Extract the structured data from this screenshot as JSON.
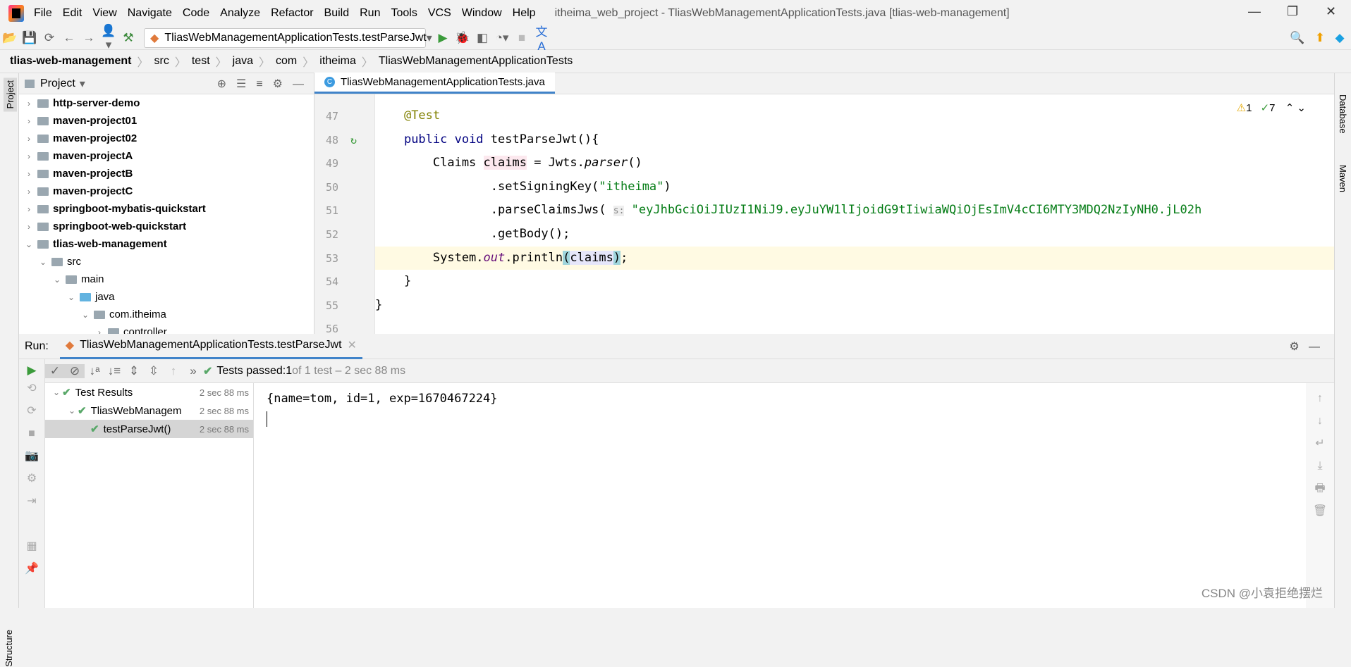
{
  "menu": [
    "File",
    "Edit",
    "View",
    "Navigate",
    "Code",
    "Analyze",
    "Refactor",
    "Build",
    "Run",
    "Tools",
    "VCS",
    "Window",
    "Help"
  ],
  "window_title": "itheima_web_project - TliasWebManagementApplicationTests.java [tlias-web-management]",
  "run_config": "TliasWebManagementApplicationTests.testParseJwt",
  "breadcrumb": [
    "tlias-web-management",
    "src",
    "test",
    "java",
    "com",
    "itheima",
    "TliasWebManagementApplicationTests"
  ],
  "project": {
    "label": "Project",
    "items": [
      {
        "label": "http-server-demo",
        "level": 0
      },
      {
        "label": "maven-project01",
        "level": 0
      },
      {
        "label": "maven-project02",
        "level": 0
      },
      {
        "label": "maven-projectA",
        "level": 0
      },
      {
        "label": "maven-projectB",
        "level": 0
      },
      {
        "label": "maven-projectC",
        "level": 0
      },
      {
        "label": "springboot-mybatis-quickstart",
        "level": 0
      },
      {
        "label": "springboot-web-quickstart",
        "level": 0
      },
      {
        "label": "tlias-web-management",
        "level": 0
      },
      {
        "label": "src",
        "level": 1
      },
      {
        "label": "main",
        "level": 2
      },
      {
        "label": "java",
        "level": 3
      },
      {
        "label": "com.itheima",
        "level": 4
      },
      {
        "label": "controller",
        "level": 5
      }
    ]
  },
  "editor": {
    "tab": "TliasWebManagementApplicationTests.java",
    "warnings": "1",
    "checks": "7",
    "lines": [
      {
        "n": "47",
        "html": "    <span class='an'>@Test</span>"
      },
      {
        "n": "48",
        "html": "    <span class='kw'>public void</span> testParseJwt(){"
      },
      {
        "n": "49",
        "html": "        Claims <span style='background:#fce8ee'>claims</span> = Jwts.<span class='it'>parser</span>()"
      },
      {
        "n": "50",
        "html": "                .setSigningKey(<span class='str'>\"itheima\"</span>)"
      },
      {
        "n": "51",
        "html": "                .parseClaimsJws( <span style='color:#888;background:#eee;font-size:13px'>s:</span> <span class='str'>\"eyJhbGciOiJIUzI1NiJ9.eyJuYW1lIjoidG9tIiwiaWQiOjEsImV4cCI6MTY3MDQ2NzIyNH0.jL02h</span>"
      },
      {
        "n": "52",
        "html": "                .getBody();"
      },
      {
        "n": "53",
        "html": "        System.<span class='out'>out</span>.println<span style='background:#9fd5dc'>(</span><span style='background:#e6e6fa'>claims</span><span style='background:#9fd5dc'>)</span>;"
      },
      {
        "n": "54",
        "html": "    }"
      },
      {
        "n": "55",
        "html": "}"
      },
      {
        "n": "56",
        "html": ""
      }
    ]
  },
  "right_strip": [
    "Database",
    "Maven"
  ],
  "left_strip": [
    "Project",
    "Structure"
  ],
  "run": {
    "label": "Run:",
    "tab": "TliasWebManagementApplicationTests.testParseJwt",
    "status_prefix": "Tests passed: ",
    "status_count": "1",
    "status_rest": " of 1 test – 2 sec 88 ms",
    "tree": [
      {
        "label": "Test Results",
        "time": "2 sec 88 ms"
      },
      {
        "label": "TliasWebManagem",
        "time": "2 sec 88 ms"
      },
      {
        "label": "testParseJwt()",
        "time": "2 sec 88 ms"
      }
    ],
    "output": "{name=tom, id=1, exp=1670467224}"
  },
  "watermark": "CSDN @小袁拒绝摆烂"
}
